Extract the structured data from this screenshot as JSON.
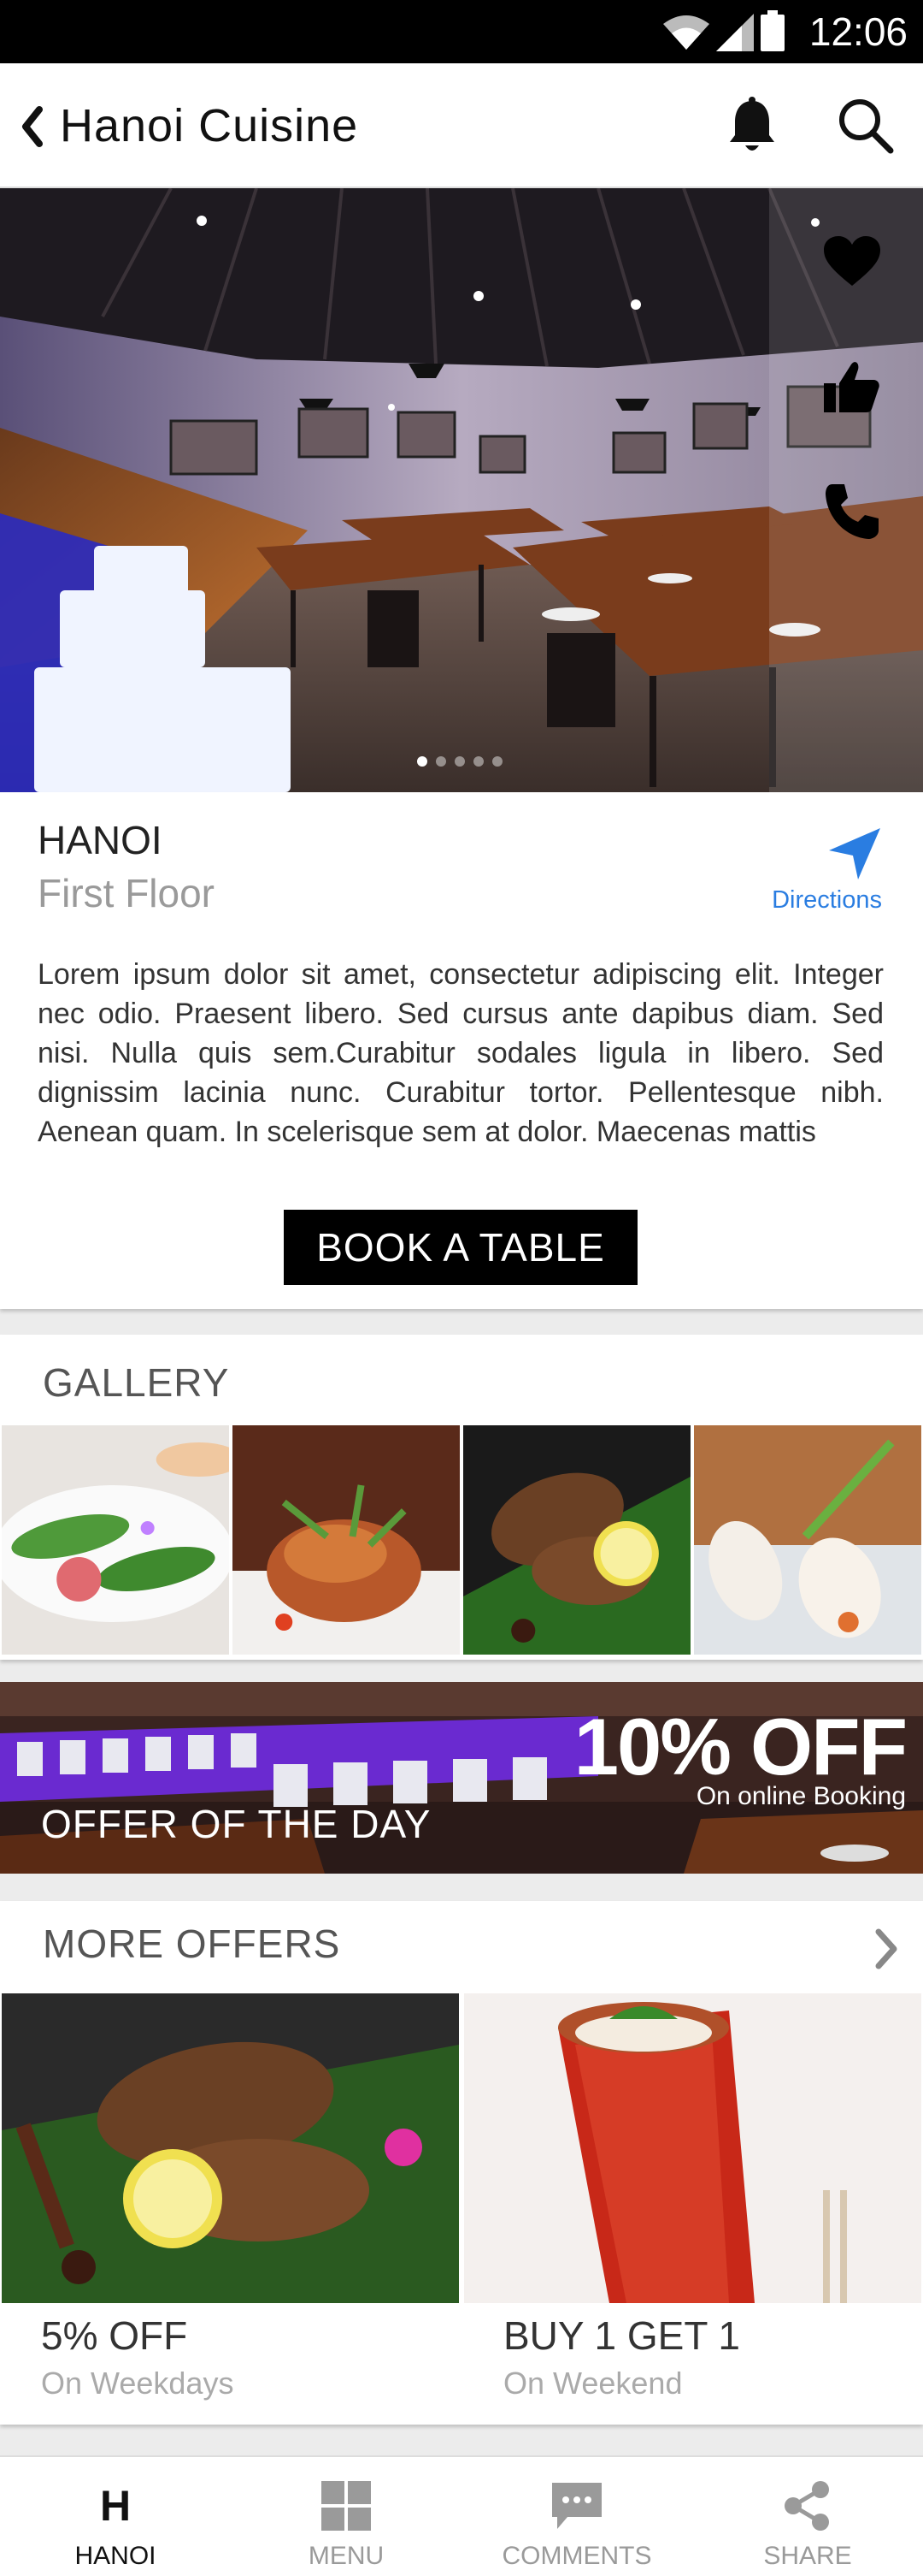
{
  "status_bar": {
    "time": "12:06"
  },
  "header": {
    "title": "Hanoi Cuisine"
  },
  "hero": {
    "active_slide": 1,
    "slide_count": 5
  },
  "restaurant": {
    "name": "HANOI",
    "floor": "First Floor",
    "directions_label": "Directions",
    "description": "Lorem ipsum dolor sit amet, consectetur adipiscing elit. Integer nec odio. Praesent libero. Sed cursus ante dapibus diam. Sed nisi. Nulla quis sem.Curabitur sodales ligula in libero. Sed dignissim lacinia nunc. Curabitur tortor. Pellentesque nibh. Aenean quam. In scelerisque sem at dolor. Maecenas mattis",
    "book_label": "BOOK A TABLE"
  },
  "gallery": {
    "title": "GALLERY"
  },
  "offer_of_day": {
    "percent": "10% OFF",
    "subtitle": "On online Booking",
    "label": "OFFER OF THE DAY"
  },
  "more_offers": {
    "title": "MORE OFFERS",
    "items": [
      {
        "title": "5% OFF",
        "subtitle": "On Weekdays"
      },
      {
        "title": "BUY 1 GET 1",
        "subtitle": "On Weekend"
      }
    ]
  },
  "bottom_nav": {
    "items": [
      {
        "label": "HANOI",
        "icon": "h-letter-icon",
        "glyph": "H"
      },
      {
        "label": "MENU",
        "icon": "grid-icon"
      },
      {
        "label": "COMMENTS",
        "icon": "comment-icon"
      },
      {
        "label": "SHARE",
        "icon": "share-icon"
      }
    ],
    "active": "HANOI"
  }
}
